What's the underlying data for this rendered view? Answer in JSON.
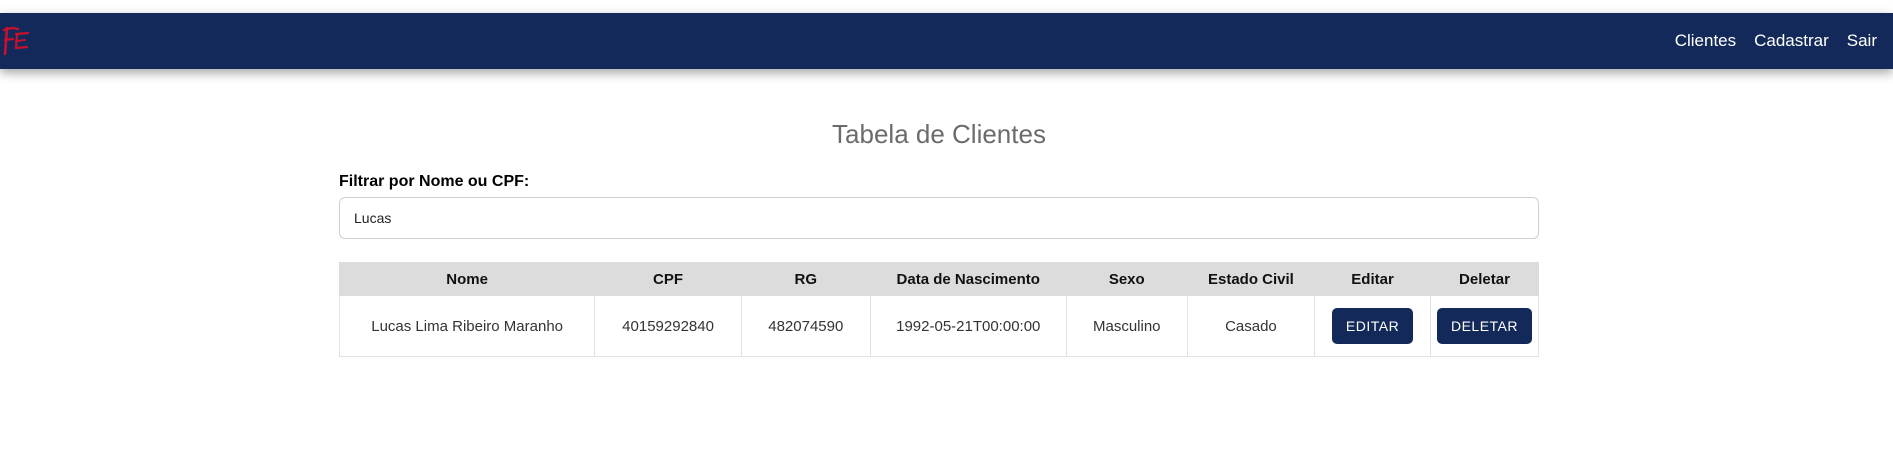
{
  "navbar": {
    "logo_text": "FE",
    "links": [
      "Clientes",
      "Cadastrar",
      "Sair"
    ]
  },
  "page": {
    "title": "Tabela de Clientes",
    "filter_label": "Filtrar por Nome ou CPF:",
    "filter_value": "Lucas"
  },
  "table": {
    "headers": [
      "Nome",
      "CPF",
      "RG",
      "Data de Nascimento",
      "Sexo",
      "Estado Civil",
      "Editar",
      "Deletar"
    ],
    "rows": [
      {
        "nome": "Lucas Lima Ribeiro Maranho",
        "cpf": "40159292840",
        "rg": "482074590",
        "data_nascimento": "1992-05-21T00:00:00",
        "sexo": "Masculino",
        "estado_civil": "Casado",
        "edit_label": "EDITAR",
        "delete_label": "DELETAR"
      }
    ]
  },
  "colors": {
    "navbar": "#13295a",
    "button": "#13295a",
    "logo": "#c8102e",
    "table_header": "#dcdcdc"
  }
}
